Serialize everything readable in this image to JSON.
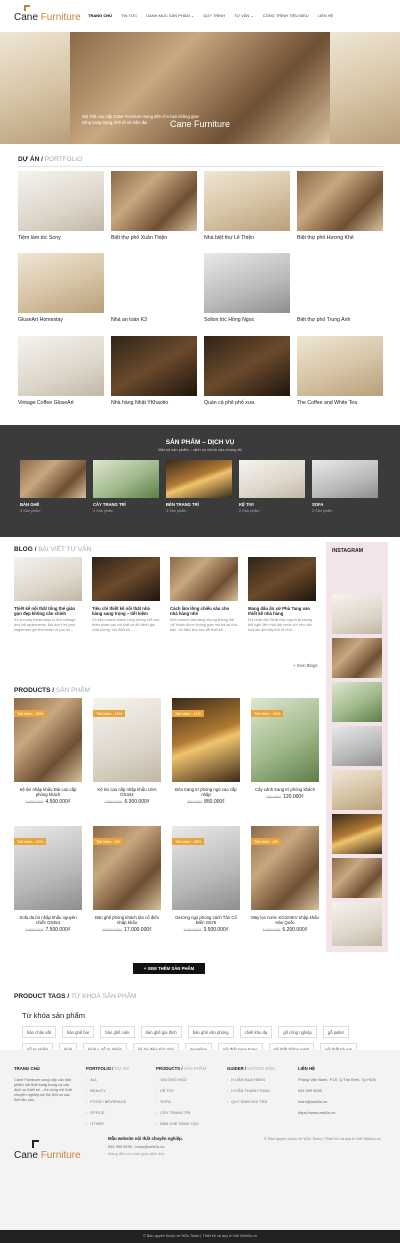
{
  "header": {
    "logo_prefix": "Cane",
    "logo_brand": "Furniture",
    "nav": [
      "TRANG CHỦ",
      "TIN TỨC",
      "DANH MỤC SẢN PHẨM ⌄",
      "QUY TRÌNH",
      "TƯ VẤN ⌄",
      "CÔNG TRÌNH TIÊU BIỂU",
      "LIÊN HỆ"
    ]
  },
  "hero": {
    "brand": "Cane Furniture",
    "caption": "Nội thất cao cấp Cane Furniture mang đến cho bạn không gian sống sang trọng, tinh tế và hiện đại"
  },
  "projects": {
    "heading": "DỰ ÁN",
    "subheading": "PORTFOLIO",
    "items": [
      "Tiệm làm tóc Sony",
      "Biệt thự phố Xuân Thiện",
      "Nhà biệt thự Lê Thiện",
      "Biệt thự phố Hương Khê",
      "GluseArt Homestay",
      "Nhà an toàn K3",
      "Sollon tóc Hồng Ngọc",
      "Biệt thự phố Trung Anh",
      "Vintage Coffee GluseArt",
      "Nhà hàng Nhật YKhaotio",
      "Quán cà phê phố xưa",
      "The Coffee and White Tea"
    ]
  },
  "services": {
    "title": "SẢN PHẨM – DỊCH VỤ",
    "subtitle": "Một số sản phẩm – dịch vụ chính của chúng tôi",
    "items": [
      {
        "name": "BÀN GHẾ",
        "count": "3 Sản phẩm"
      },
      {
        "name": "CÂY TRANG TRÍ",
        "count": "2 Sản phẩm"
      },
      {
        "name": "ĐÈN TRANG TRÍ",
        "count": "3 Sản phẩm"
      },
      {
        "name": "KỆ TIVI",
        "count": "2 Sản phẩm"
      },
      {
        "name": "SOFA",
        "count": "2 Sản phẩm"
      }
    ]
  },
  "blog": {
    "heading": "BLOG",
    "subheading": "BÀI VIẾT TƯ VẤN",
    "more": "+ Xem Blogs",
    "items": [
      {
        "title": "Thiết kế nội thất tổng thể giản gọn đẹp không cần chỉnh",
        "excerpt": "It's so easy these days to find cottage and loft apartments. But don't let your eagerness get the better of you de..."
      },
      {
        "title": "Tiêu chí thiết kế nội thất nhà hàng sang trọng – tiết kiệm",
        "excerpt": "Có kinh doanh thành công không thể nào thiếu phần cao nội thất và đủ đánh giá chất lượng, nói thiết kế..."
      },
      {
        "title": "Cách làm lồng chiếu sâu cho nhà hàng nhỏ",
        "excerpt": "Kinh doanh nhà hàng nhưng không thể chỉ thuần được không gian mà trả lại của bạn. Và điều làm sao để thiết kế..."
      },
      {
        "title": "Mang dấu ấn xứ Phù Tang vào thiết kế nhà hàng",
        "excerpt": "Khi nhắc đến Nhật Bản người ta không thể nghĩ đến một đất nước với nền văn hoá lâu đời đầy tinh tế như..."
      }
    ]
  },
  "instagram": {
    "heading": "INSTAGRAM"
  },
  "products": {
    "heading": "PRODUCTS",
    "subheading": "SẢN PHẨM",
    "items": [
      {
        "badge": "Tiết kiệm: -20%",
        "name": "Kệ tivi nhập khẩu Đài cao cấp phòng khách",
        "old": "5.650.000₫",
        "price": "4.500.000₫"
      },
      {
        "badge": "Tiết kiệm: -16%",
        "name": "Kệ tivi cao cấp nhập khẩu USA GS344",
        "old": "7.500.000₫",
        "price": "6.300.000₫"
      },
      {
        "badge": "Tiết kiệm: -11%",
        "name": "Đèn trang trí phòng ngủ cao cấp nhập",
        "old": "950.000₫",
        "price": "850.000₫"
      },
      {
        "badge": "Tiết kiệm: -20%",
        "name": "Cây cảnh trang trí phòng khách",
        "old": "150.000₫",
        "price": "120.000₫"
      },
      {
        "badge": "Tiết kiệm: -23%",
        "name": "Sofa da bò nhập khẩu nguyên chiếc G5454",
        "old": "9.800.000₫",
        "price": "7.500.000₫"
      },
      {
        "badge": "Tiết kiệm: -6%",
        "name": "Bàn ghế phòng khách tân cổ điển nhập khẩu",
        "old": "18.000.000₫",
        "price": "17.000.000₫"
      },
      {
        "badge": "Tiết kiệm: -35%",
        "name": "Giường ngủ phong cách Tân Cổ Điển G576",
        "old": "5.400.000₫",
        "price": "3.500.000₫"
      },
      {
        "badge": "Tiết kiệm: -4%",
        "name": "Máy lọc nước KG104KV nhập khẩu Hàn Quốc",
        "old": "5.450.000₫",
        "price": "5.200.000₫"
      }
    ],
    "more_button": "+ XEM THÊM SẢN PHẨM"
  },
  "tags": {
    "heading": "PRODUCT TAGS",
    "subheading": "TỪ KHOÁ SẢN PHẨM",
    "title": "Từ khóa sản phẩm",
    "items": [
      "bàn chân sắt",
      "bàn ghế bar",
      "bàn ghế cafe",
      "bàn ghế gia đình",
      "bàn ghế văn phòng",
      "chiết khu dạ",
      "gỗ công nghiệp",
      "gỗ pallet",
      "gỗ tự nhiên",
      "kính",
      "kính + gỗ tự nhiên",
      "kệ tivi điện tích nhỏ",
      "menaline",
      "nội thất sang trọng",
      "nội thất thông minh",
      "nội thất trẻ em",
      "vân gỗ"
    ]
  },
  "footer": {
    "about_h": "TRANG CHỦ",
    "about": "Cane Furniture xung cấp các sản phẩm nội thất sang trọng và các dịch vụ thiết kế – thi công nội thất chuyên nghiệp tại Hà Nội và các tỉnh lân cận.",
    "portfolio_h": "PORTFOLIO",
    "portfolio_sub": "DỰ ÁN",
    "portfolio": [
      "ALL",
      "BEAUTY",
      "FOOD / BEVERAGE",
      "OFFICE",
      "OTHER"
    ],
    "products_h": "PRODUCTS",
    "products_sub": "SẢN PHẨM",
    "products": [
      "GIƯỜNG NGỦ",
      "KỆ TIVI",
      "SOFA",
      "CÂY TRANG TRÍ",
      "BÀN CHẾ SÁNG TẠO"
    ],
    "guide_h": "GUIDER",
    "guide_sub": "HƯỚNG DẪN",
    "guide": [
      "H.DẪN MUA HÀNG",
      "H.DẪN THANH TOÁN",
      "QUY ĐỊNH ĐỔI TRẢ"
    ],
    "contact_h": "LIÊN HỆ",
    "contact": [
      "Phòng Văn Banh, P.15, Q.Tân Bình, Tp HCM",
      "094 999 9295",
      "hotro@web2s.vn",
      "https://www.web2s.vn"
    ],
    "bottom_logo_prefix": "Cane",
    "bottom_logo_brand": "Furniture",
    "slogan": "Mẫu website nội thất chuyên nghiệp.",
    "phone_line": "094 999 9295 - hotro@web2s.vn",
    "note": "Mang đến cho bạn giao diện đẹp",
    "credit": "© Bản quyền thuộc về W2s Team | Thiết kế và duy trì bởi Web2s.vn",
    "bar": "© Bản quyền thuộc về W2s Team | Thiết kế và duy trì bởi Web2s.vn"
  }
}
